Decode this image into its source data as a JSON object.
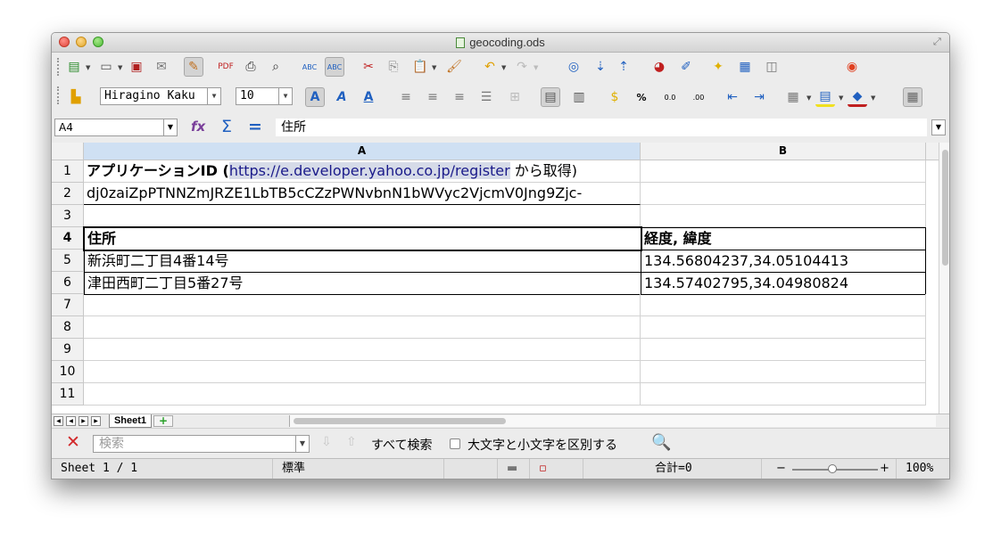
{
  "window": {
    "title": "geocoding.ods"
  },
  "toolbar2": {
    "font_name": "Hiragino Kaku",
    "font_size": "10"
  },
  "formula_bar": {
    "cell_ref": "A4",
    "content": "住所"
  },
  "sheet": {
    "columns": [
      "A",
      "B"
    ],
    "row_numbers": [
      "1",
      "2",
      "3",
      "4",
      "5",
      "6",
      "7",
      "8",
      "9",
      "10",
      "11"
    ],
    "a1_prefix": "アプリケーションID (",
    "a1_link": "https://e.developer.yahoo.co.jp/register",
    "a1_suffix": " から取得)",
    "a2": "dj0zaiZpPTNNZmJRZE1LbTB5cCZzPWNvbnN1bWVyc2VjcmV0Jng9Zjc-",
    "header_address": "住所",
    "header_coords": "経度, 緯度",
    "rows": [
      {
        "address": "新浜町二丁目4番14号",
        "coords": "134.56804237,34.05104413"
      },
      {
        "address": "津田西町二丁目5番27号",
        "coords": "134.57402795,34.04980824"
      }
    ]
  },
  "tabs": {
    "sheet_name": "Sheet1"
  },
  "findbar": {
    "placeholder": "検索",
    "find_all_label": "すべて検索",
    "match_case_label": "大文字と小文字を区別する"
  },
  "status": {
    "sheet_info": "Sheet 1 / 1",
    "page_style": "標準",
    "sum": "合計=0",
    "zoom": "100%"
  },
  "colors": {
    "link_bg": "#d6dbe8",
    "selected_col_header": "#cfe0f3",
    "close_red": "#d2282a"
  }
}
